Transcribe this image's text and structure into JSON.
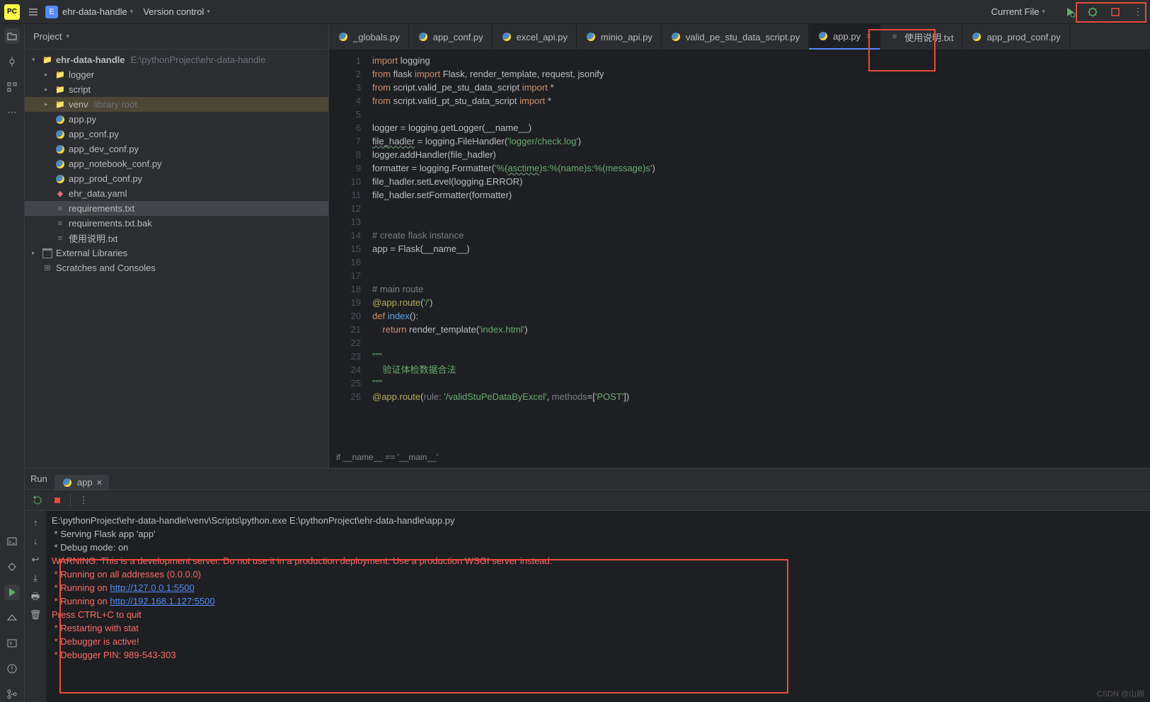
{
  "top": {
    "project_badge": "E",
    "project_name": "ehr-data-handle",
    "vcs": "Version control",
    "current_file": "Current File"
  },
  "project_panel": {
    "title": "Project"
  },
  "tree": {
    "root": "ehr-data-handle",
    "root_path": "E:\\pythonProject\\ehr-data-handle",
    "items": [
      {
        "label": "logger",
        "type": "dir"
      },
      {
        "label": "script",
        "type": "dir"
      },
      {
        "label": "venv",
        "type": "dir",
        "hint": "library root"
      },
      {
        "label": "app.py",
        "type": "py"
      },
      {
        "label": "app_conf.py",
        "type": "py"
      },
      {
        "label": "app_dev_conf.py",
        "type": "py"
      },
      {
        "label": "app_notebook_conf.py",
        "type": "py"
      },
      {
        "label": "app_prod_conf.py",
        "type": "py"
      },
      {
        "label": "ehr_data.yaml",
        "type": "yaml"
      },
      {
        "label": "requirements.txt",
        "type": "txt"
      },
      {
        "label": "requirements.txt.bak",
        "type": "txt"
      },
      {
        "label": "使用说明.txt",
        "type": "txt"
      }
    ],
    "ext_lib": "External Libraries",
    "scratches": "Scratches and Consoles"
  },
  "tabs": [
    {
      "label": "_globals.py",
      "icon": "py"
    },
    {
      "label": "app_conf.py",
      "icon": "py"
    },
    {
      "label": "excel_api.py",
      "icon": "py"
    },
    {
      "label": "minio_api.py",
      "icon": "py"
    },
    {
      "label": "valid_pe_stu_data_script.py",
      "icon": "py"
    },
    {
      "label": "app.py",
      "icon": "py",
      "active": true
    },
    {
      "label": "使用说明.txt",
      "icon": "txt"
    },
    {
      "label": "app_prod_conf.py",
      "icon": "py"
    }
  ],
  "code_lines": [
    {
      "n": 1,
      "h": "<span class='kw'>import</span> logging"
    },
    {
      "n": 2,
      "h": "<span class='kw'>from</span> flask <span class='kw'>import</span> Flask, render_template, request, jsonify"
    },
    {
      "n": 3,
      "h": "<span class='kw'>from</span> script.valid_pe_stu_data_script <span class='kw'>import</span> *"
    },
    {
      "n": 4,
      "h": "<span class='kw'>from</span> script.valid_pt_stu_data_script <span class='kw'>import</span> *"
    },
    {
      "n": 5,
      "h": ""
    },
    {
      "n": 6,
      "h": "logger = logging.getLogger(__name__)"
    },
    {
      "n": 7,
      "h": "<span class='ul'>file_hadler</span> = logging.FileHandler(<span class='str'>'logger/check.log'</span>)"
    },
    {
      "n": 8,
      "h": "logger.addHandler(file_hadler)"
    },
    {
      "n": 9,
      "h": "formatter = logging.Formatter(<span class='str'>'%(<span class='ul'>asctime</span>)s:%(name)s:%(message)s'</span>)"
    },
    {
      "n": 10,
      "h": "file_hadler.setLevel(logging.ERROR)"
    },
    {
      "n": 11,
      "h": "file_hadler.setFormatter(formatter)"
    },
    {
      "n": 12,
      "h": ""
    },
    {
      "n": 13,
      "h": ""
    },
    {
      "n": 14,
      "h": "<span class='cm'># create flask instance</span>"
    },
    {
      "n": 15,
      "h": "app = Flask(__name__)"
    },
    {
      "n": 16,
      "h": ""
    },
    {
      "n": 17,
      "h": ""
    },
    {
      "n": 18,
      "h": "<span class='cm'># main route</span>"
    },
    {
      "n": 19,
      "h": "<span class='dec'>@app.route</span>(<span class='str'>'/'</span>)"
    },
    {
      "n": 20,
      "h": "<span class='kw'>def</span> <span class='fn'>index</span>():"
    },
    {
      "n": 21,
      "h": "    <span class='kw'>return</span> render_template(<span class='str'>'index.html'</span>)"
    },
    {
      "n": 22,
      "h": ""
    },
    {
      "n": 23,
      "h": "<span class='str'>\"\"\"</span>"
    },
    {
      "n": 24,
      "h": "<span class='str'>    验证体检数据合法</span>"
    },
    {
      "n": 25,
      "h": "<span class='str'>\"\"\"</span>"
    },
    {
      "n": 26,
      "h": "<span class='dec'>@app.route</span>(<span class='cm'>rule:</span> <span class='str'>'/validStuPeDataByExcel'</span>, <span class='cm'>methods</span>=[<span class='str'>'POST'</span>])"
    }
  ],
  "crumb": "if __name__ == '__main__'",
  "run": {
    "title": "Run",
    "tab": "app",
    "lines_plain": [
      "E:\\pythonProject\\ehr-data-handle\\venv\\Scripts\\python.exe E:\\pythonProject\\ehr-data-handle\\app.py",
      " * Serving Flask app 'app'",
      " * Debug mode: on"
    ],
    "warn": "WARNING: This is a development server. Do not use it in a production deployment. Use a production WSGI server instead.",
    "l1": " * Running on all addresses (0.0.0.0)",
    "l2a": " * Running on ",
    "l2b": "http://127.0.0.1:5500",
    "l3a": " * Running on ",
    "l3b": "http://192.168.1.127:5500",
    "l4": "Press CTRL+C to quit",
    "l5": " * Restarting with stat",
    "l6": " * Debugger is active!",
    "l7": " * Debugger PIN: 989-543-303"
  },
  "watermark": "CSDN @山崩"
}
